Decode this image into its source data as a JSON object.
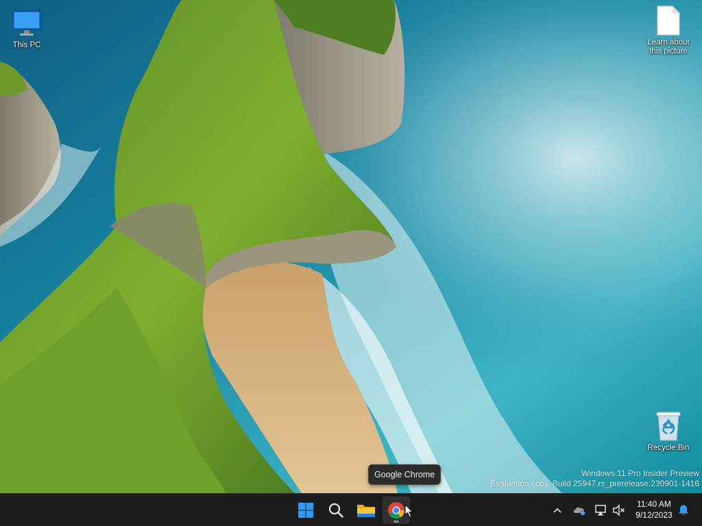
{
  "desktop": {
    "icons": [
      {
        "label": "This PC",
        "icon": "monitor-icon"
      },
      {
        "label": "Learn about this picture",
        "icon": "document-icon"
      },
      {
        "label": "Recycle Bin",
        "icon": "recycle-bin-icon"
      }
    ],
    "watermark": {
      "line1": "Windows 11 Pro Insider Preview",
      "line2": "Evaluation copy. Build 25947.rs_prerelease.230901-1416"
    }
  },
  "tooltip": {
    "text": "Google Chrome"
  },
  "taskbar": {
    "apps": [
      {
        "name": "Start",
        "icon": "windows-logo-icon"
      },
      {
        "name": "Search",
        "icon": "search-icon"
      },
      {
        "name": "File Explorer",
        "icon": "folder-icon"
      },
      {
        "name": "Google Chrome",
        "icon": "chrome-icon"
      }
    ],
    "tray": {
      "time": "11:40 AM",
      "date": "9/12/2023",
      "icons": [
        "chevron-up-icon",
        "onedrive-icon",
        "network-icon",
        "volume-muted-icon",
        "notification-bell-icon"
      ]
    }
  },
  "colors": {
    "taskbar_bg": "#1c1c1c",
    "accent_blue": "#2f80ed",
    "sea": "#1b7a93"
  }
}
